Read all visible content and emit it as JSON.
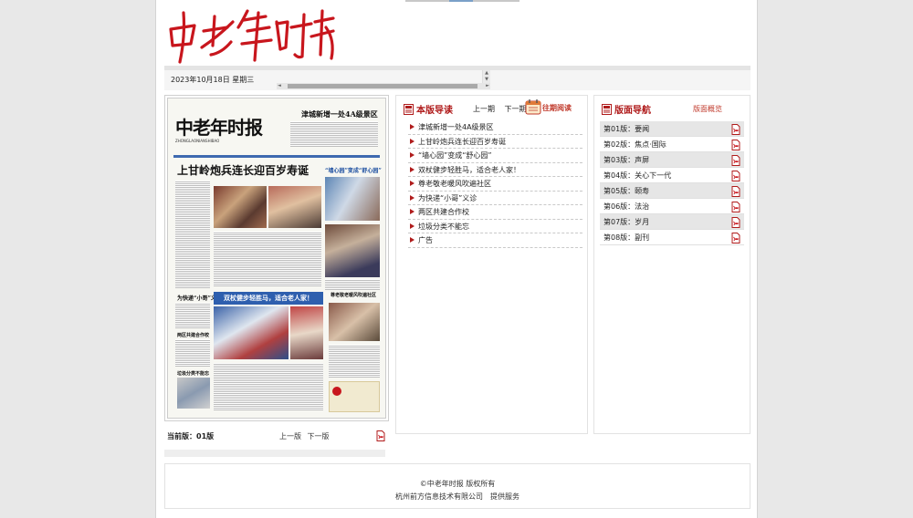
{
  "masthead": {
    "logo_text": "中老年时报"
  },
  "date_bar": {
    "date": "2023年10月18日 星期三"
  },
  "newspaper": {
    "masthead": "中老年时报",
    "pinyin": "ZHONGLAONIANSHIBAO",
    "top_headline": "津城新增一处4A级景区",
    "main_headline": "上甘岭炮兵连长迎百岁寿诞",
    "side_headline": "“墙心园”变成“舒心园”",
    "mid_headline": "双杖健步轻胜马，适合老人家！",
    "left_headline": "为快递“小哥”义诊",
    "left_headline2": "两区共建合作校",
    "left_headline3": "垃圾分类不能忘",
    "right_headline": "尊老敬老暖风吹遍社区"
  },
  "pager": {
    "current_label": "当前版：",
    "current_value": "01版",
    "prev": "上一版",
    "next": "下一版"
  },
  "reading": {
    "title": "本版导读",
    "prev": "上一期",
    "next": "下一期",
    "past": "往期阅读",
    "articles": [
      "津城新增一处4A级景区",
      "上甘岭炮兵连长迎百岁寿诞",
      "“墙心园”变成“舒心园”",
      "双杖健步轻胜马，适合老人家！",
      "尊老敬老暖风吹遍社区",
      "为快递“小哥”义诊",
      "两区共建合作校",
      "垃圾分类不能忘",
      "广告"
    ]
  },
  "edition_nav": {
    "title": "版面导航",
    "summary": "版面概览",
    "editions": [
      "第01版：要闻",
      "第02版：焦点·国际",
      "第03版：声屏",
      "第04版：关心下一代",
      "第05版：颐寿",
      "第06版：法治",
      "第07版：岁月",
      "第08版：副刊"
    ]
  },
  "footer": {
    "copyright": "©中老年时报 版权所有",
    "provider": "杭州前方信息技术有限公司　提供服务"
  },
  "colors": {
    "accent_red": "#b01c1c",
    "link_red": "#c0392b",
    "paper_blue": "#2e5fae"
  }
}
